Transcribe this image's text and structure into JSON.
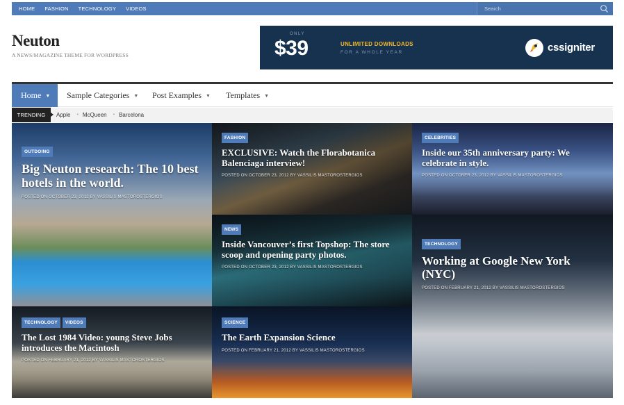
{
  "topbar": {
    "nav": [
      "HOME",
      "FASHION",
      "TECHNOLOGY",
      "VIDEOS"
    ],
    "search_placeholder": "Search"
  },
  "site": {
    "title": "Neuton",
    "tagline": "A NEWS/MAGAZINE THEME FOR WORDPRESS"
  },
  "ad": {
    "only": "ONLY",
    "price": "$39",
    "line1": "UNLIMITED DOWNLOADS",
    "line2": "FOR A WHOLE YEAR",
    "brand": "cssigniter"
  },
  "mainnav": {
    "items": [
      "Home",
      "Sample Categories",
      "Post Examples",
      "Templates"
    ],
    "active": "Home"
  },
  "trending": {
    "label": "TRENDING",
    "links": [
      "Apple",
      "McQueen",
      "Barcelona"
    ]
  },
  "tiles": [
    {
      "badges": [
        "OUTDOING"
      ],
      "title": "Big Neuton research: The 10 best hotels in the world.",
      "meta": "POSTED ON OCTOBER 23, 2012 BY VASSILIS MASTOROSTERGIOS"
    },
    {
      "badges": [
        "FASHION"
      ],
      "title": "EXCLUSIVE: Watch the Florabotanica Balenciaga interview!",
      "meta": "POSTED ON OCTOBER 23, 2012 BY VASSILIS MASTOROSTERGIOS"
    },
    {
      "badges": [
        "CELEBRITIES"
      ],
      "title": "Inside our 35th anniversary party: We celebrate in style.",
      "meta": "POSTED ON OCTOBER 23, 2012 BY VASSILIS MASTOROSTERGIOS"
    },
    {
      "badges": [
        "NEWS"
      ],
      "title": "Inside Vancouver’s first Topshop: The store scoop and opening party photos.",
      "meta": "POSTED ON OCTOBER 23, 2012 BY VASSILIS MASTOROSTERGIOS"
    },
    {
      "badges": [
        "TECHNOLOGY"
      ],
      "title": "Working at Google New York (NYC)",
      "meta": "POSTED ON FEBRUARY 21, 2012 BY VASSILIS MASTOROSTERGIOS"
    },
    {
      "badges": [
        "TECHNOLOGY",
        "VIDEOS"
      ],
      "title": "The Lost 1984 Video: young Steve Jobs introduces the Macintosh",
      "meta": "POSTED ON FEBRUARY 21, 2012 BY VASSILIS MASTOROSTERGIOS"
    },
    {
      "badges": [
        "SCIENCE"
      ],
      "title": "The Earth Expansion Science",
      "meta": "POSTED ON FEBRUARY 21, 2012 BY VASSILIS MASTOROSTERGIOS"
    }
  ],
  "colors": {
    "accent": "#4f7bb8",
    "dark": "#222222",
    "ad_bg": "#17324f",
    "ad_highlight": "#f0b72a"
  },
  "icons": [
    "search-icon",
    "cssigniter-logo-icon",
    "caret-down-icon"
  ]
}
